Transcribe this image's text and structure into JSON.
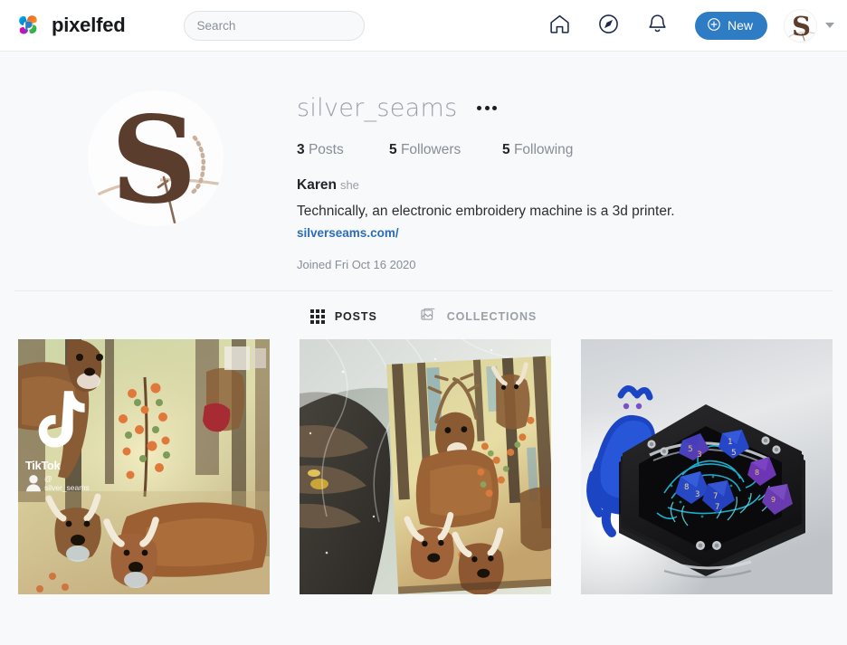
{
  "brand": {
    "name": "pixelfed",
    "logo_icon": "pixelfed-logo-icon"
  },
  "search": {
    "placeholder": "Search",
    "value": ""
  },
  "nav": {
    "home_icon": "home-icon",
    "discover_icon": "compass-icon",
    "notifications_icon": "bell-icon",
    "new_label": "New",
    "new_icon": "plus-circle-icon",
    "avatar_icon": "avatar-silver-seams",
    "caret_icon": "chevron-down-icon",
    "accent_color": "#2e7cc3"
  },
  "profile": {
    "username": "silver_seams",
    "more_icon": "ellipsis-icon",
    "stats": [
      {
        "count": "3",
        "label": "Posts"
      },
      {
        "count": "5",
        "label": "Followers"
      },
      {
        "count": "5",
        "label": "Following"
      }
    ],
    "display_name": "Karen",
    "pronouns": "she",
    "bio": "Technically, an electronic embroidery machine is a 3d printer.",
    "website": "silverseams.com/",
    "website_color": "#2b6cb8",
    "joined": "Joined Fri Oct 16 2020",
    "avatar_letter": "S",
    "avatar_color": "#5b3d2e"
  },
  "tabs": [
    {
      "label": "POSTS",
      "icon": "grid-icon",
      "active": true
    },
    {
      "label": "COLLECTIONS",
      "icon": "collections-icon",
      "active": false
    }
  ],
  "posts": [
    {
      "alt": "Deer forest printed fabric TikTok screenshot",
      "watermark": {
        "brand": "TikTok",
        "handle": "@ silver_seams"
      }
    },
    {
      "alt": "Deer forest printed fabric under tulle held by hand",
      "watermark": null
    },
    {
      "alt": "Black hexagonal dice tray with embroidered dragon and purple blue dice",
      "watermark": null
    }
  ]
}
